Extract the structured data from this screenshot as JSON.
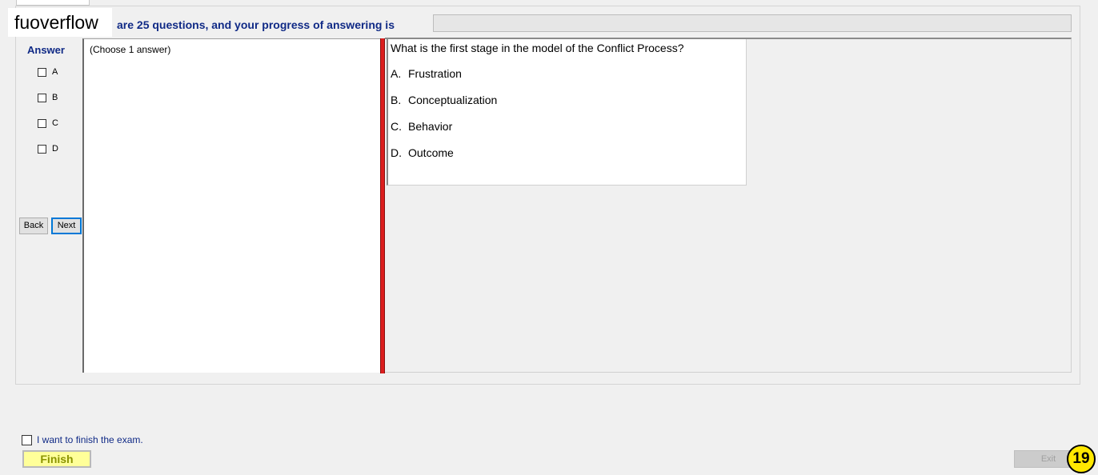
{
  "header": {
    "watermark": "fuoverflow",
    "progress_text": "are 25 questions, and your progress of answering is",
    "progress_value": 0
  },
  "answer_panel": {
    "heading": "Answer",
    "options": [
      {
        "label": "A",
        "checked": false
      },
      {
        "label": "B",
        "checked": false
      },
      {
        "label": "C",
        "checked": false
      },
      {
        "label": "D",
        "checked": false
      }
    ],
    "back_label": "Back",
    "next_label": "Next"
  },
  "instruction": "(Choose 1 answer)",
  "question": {
    "text": "What is the first stage in the model of the Conflict Process?",
    "choices": [
      {
        "letter": "A.",
        "text": "Frustration"
      },
      {
        "letter": "B.",
        "text": "Conceptualization"
      },
      {
        "letter": "C.",
        "text": "Behavior"
      },
      {
        "letter": "D.",
        "text": "Outcome"
      }
    ]
  },
  "footer": {
    "finish_check_label": "I want to finish the exam.",
    "finish_label": "Finish",
    "exit_label": "Exit",
    "step_badge": "19"
  },
  "colors": {
    "accent_text": "#102a86",
    "splitter": "#dc1e1e",
    "finish_bg": "#ffff99",
    "badge": "#ffe800"
  }
}
